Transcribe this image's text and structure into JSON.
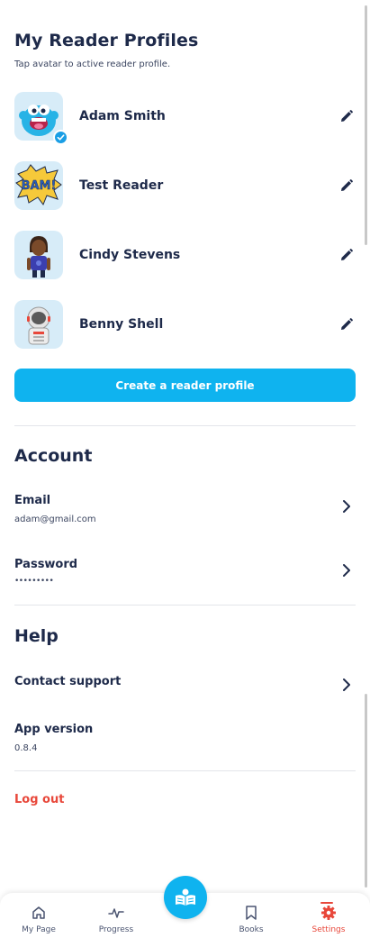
{
  "profiles_section": {
    "title": "My Reader Profiles",
    "subtitle": "Tap avatar to active reader profile.",
    "profiles": [
      {
        "name": "Adam Smith",
        "avatar": "blue-monster-avatar",
        "active": true
      },
      {
        "name": "Test Reader",
        "avatar": "bam-comic-avatar",
        "active": false
      },
      {
        "name": "Cindy Stevens",
        "avatar": "girl-avatar",
        "active": false
      },
      {
        "name": "Benny Shell",
        "avatar": "astronaut-avatar",
        "active": false
      }
    ],
    "create_button": "Create a reader profile"
  },
  "account": {
    "title": "Account",
    "email_label": "Email",
    "email_value": "adam@gmail.com",
    "password_label": "Password",
    "password_value": "•••••••••"
  },
  "help": {
    "title": "Help",
    "contact_label": "Contact support",
    "version_label": "App version",
    "version_value": "0.8.4"
  },
  "logout_label": "Log out",
  "tabbar": {
    "tabs": [
      {
        "label": "My Page",
        "icon": "home-icon"
      },
      {
        "label": "Progress",
        "icon": "pulse-icon"
      },
      {
        "label": "Books",
        "icon": "bookmark-icon"
      },
      {
        "label": "Settings",
        "icon": "gear-icon",
        "active": true
      }
    ],
    "center_icon": "open-book-icon"
  },
  "colors": {
    "primary": "#0fb3ef",
    "text": "#1e2a4a",
    "danger": "#e8473a",
    "avatar_bg": "#d7ecf8"
  }
}
